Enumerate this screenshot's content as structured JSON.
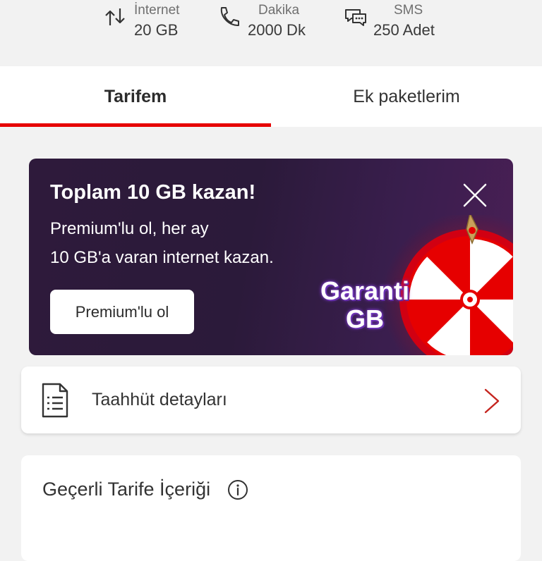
{
  "usage": [
    {
      "icon": "data-transfer-icon",
      "label": "İnternet",
      "value": "20 GB"
    },
    {
      "icon": "phone-icon",
      "label": "Dakika",
      "value": "2000 Dk"
    },
    {
      "icon": "sms-chat-icon",
      "label": "SMS",
      "value": "250 Adet"
    }
  ],
  "tabs": [
    {
      "label": "Tarifem",
      "active": true
    },
    {
      "label": "Ek paketlerim",
      "active": false
    }
  ],
  "promo": {
    "title": "Toplam 10 GB kazan!",
    "line1": "Premium'lu ol, her ay",
    "line2": "10 GB'a varan internet kazan.",
    "button": "Premium'lu ol",
    "art_text_1": "Garanti",
    "art_text_2": "GB"
  },
  "taahhut": {
    "label": "Taahhüt detayları"
  },
  "tarife": {
    "title": "Geçerli Tarife İçeriği"
  },
  "colors": {
    "accent": "#e60000",
    "promo_bg": "#2d1b3c"
  }
}
